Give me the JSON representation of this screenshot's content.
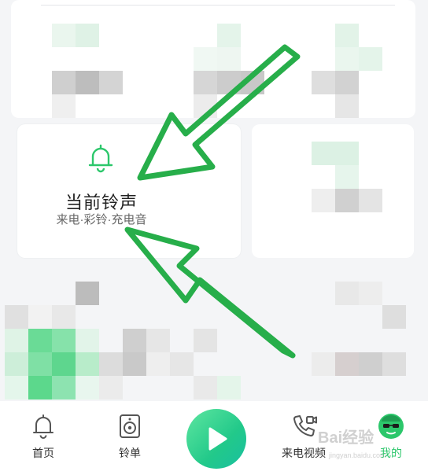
{
  "card": {
    "title": "当前铃声",
    "subtitle": "来电·彩铃·充电音",
    "icon": "bell-icon"
  },
  "tabbar": {
    "tabs": [
      {
        "label": "首页",
        "icon": "bell-home-icon"
      },
      {
        "label": "铃单",
        "icon": "speaker-list-icon"
      },
      {
        "label": "来电视频",
        "icon": "phone-video-icon"
      },
      {
        "label": "我的",
        "icon": "avatar-icon"
      }
    ],
    "play_icon": "play-icon",
    "active_color": "#2cc76b"
  },
  "watermark": {
    "text": "Bai经验",
    "url": "jingyan.baidu.com"
  },
  "colors": {
    "accent": "#2cc76b",
    "arrow": "#27ae4a"
  }
}
